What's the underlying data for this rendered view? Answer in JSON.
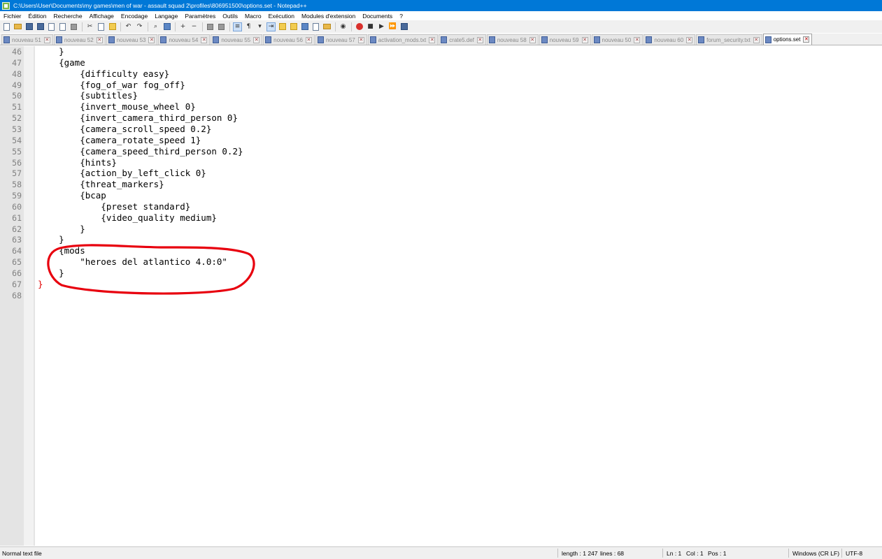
{
  "window": {
    "title": "C:\\Users\\User\\Documents\\my games\\men of war - assault squad 2\\profiles\\806951500\\options.set - Notepad++"
  },
  "menu": [
    "Fichier",
    "Édition",
    "Recherche",
    "Affichage",
    "Encodage",
    "Langage",
    "Paramètres",
    "Outils",
    "Macro",
    "Exécution",
    "Modules d'extension",
    "Documents",
    "?"
  ],
  "tabs": [
    {
      "label": "nouveau 51",
      "active": false
    },
    {
      "label": "nouveau 52",
      "active": false
    },
    {
      "label": "nouveau 53",
      "active": false
    },
    {
      "label": "nouveau 54",
      "active": false
    },
    {
      "label": "nouveau 55",
      "active": false
    },
    {
      "label": "nouveau 56",
      "active": false
    },
    {
      "label": "nouveau 57",
      "active": false
    },
    {
      "label": "activation_mods.txt",
      "active": false
    },
    {
      "label": "crate5.def",
      "active": false
    },
    {
      "label": "nouveau 58",
      "active": false
    },
    {
      "label": "nouveau 59",
      "active": false
    },
    {
      "label": "nouveau 50",
      "active": false
    },
    {
      "label": "nouveau 60",
      "active": false
    },
    {
      "label": "forum_security.txt",
      "active": false
    },
    {
      "label": "options.set",
      "active": true
    }
  ],
  "editor": {
    "lines": [
      {
        "num": "46",
        "text": "    }"
      },
      {
        "num": "47",
        "text": "    {game"
      },
      {
        "num": "48",
        "text": "        {difficulty easy}"
      },
      {
        "num": "49",
        "text": "        {fog_of_war fog_off}"
      },
      {
        "num": "50",
        "text": "        {subtitles}"
      },
      {
        "num": "51",
        "text": "        {invert_mouse_wheel 0}"
      },
      {
        "num": "52",
        "text": "        {invert_camera_third_person 0}"
      },
      {
        "num": "53",
        "text": "        {camera_scroll_speed 0.2}"
      },
      {
        "num": "54",
        "text": "        {camera_rotate_speed 1}"
      },
      {
        "num": "55",
        "text": "        {camera_speed_third_person 0.2}"
      },
      {
        "num": "56",
        "text": "        {hints}"
      },
      {
        "num": "57",
        "text": "        {action_by_left_click 0}"
      },
      {
        "num": "58",
        "text": "        {threat_markers}"
      },
      {
        "num": "59",
        "text": "        {bcap"
      },
      {
        "num": "60",
        "text": "            {preset standard}"
      },
      {
        "num": "61",
        "text": "            {video_quality medium}"
      },
      {
        "num": "62",
        "text": "        }"
      },
      {
        "num": "63",
        "text": "    }"
      },
      {
        "num": "64",
        "text": "    {mods"
      },
      {
        "num": "65",
        "text": "        \"heroes del atlantico 4.0:0\""
      },
      {
        "num": "66",
        "text": "    }"
      },
      {
        "num": "67",
        "text": "}",
        "red": true
      },
      {
        "num": "68",
        "text": ""
      }
    ]
  },
  "statusbar": {
    "filetype": "Normal text file",
    "length": "length : 1 247",
    "lines": "lines : 68",
    "ln": "Ln : 1",
    "col": "Col : 1",
    "pos": "Pos : 1",
    "eol": "Windows (CR LF)",
    "encoding": "UTF-8"
  },
  "colors": {
    "title_bar": "#0078d7",
    "annotation": "#e8000e",
    "closing_brace": "#e00000"
  }
}
